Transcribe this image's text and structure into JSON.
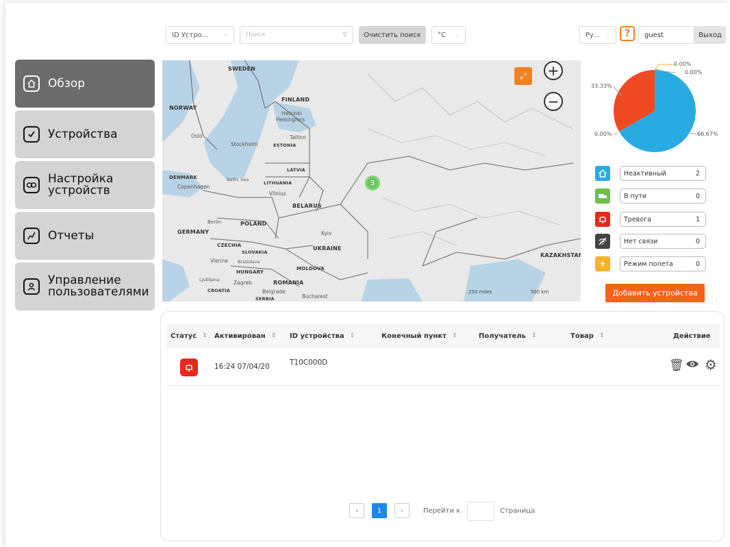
{
  "topbar": {
    "device_select": "ID Устро...",
    "search_placeholder": "Поиск",
    "clear_button": "Очистить поиск",
    "temp_unit": "°C",
    "language": "Ру...",
    "help": "?",
    "username": "guest",
    "logout": "Выход"
  },
  "sidebar": {
    "items": [
      {
        "label": "Обзор",
        "icon": "home-icon"
      },
      {
        "label": "Устройства",
        "icon": "check-icon"
      },
      {
        "label": "Настройка\nустройств",
        "icon": "link-icon"
      },
      {
        "label": "Отчеты",
        "icon": "chart-icon"
      },
      {
        "label": "Управление\nпользователями",
        "icon": "user-icon"
      }
    ]
  },
  "map": {
    "countries": [
      "SWEDEN",
      "NORWAY",
      "FINLAND",
      "ESTONIA",
      "LATVIA",
      "DENMARK",
      "LITHUANIA",
      "BELARUS",
      "POLAND",
      "GERMANY",
      "CZECHIA",
      "SLOVAKIA",
      "UKRAINE",
      "HUNGARY",
      "MOLDOVA",
      "ROMANIA",
      "CROATIA",
      "SERBIA",
      "KAZAKHSTAN"
    ],
    "cities": [
      "Helsinki",
      "Helsingfors",
      "Oslo",
      "Stockholm",
      "Tallinn",
      "Copenhagen",
      "Baltic Sea",
      "Vilnius",
      "Berlin",
      "Kyiv",
      "Vienna",
      "Bratislava",
      "Zagreb",
      "Ljubljana",
      "Belgrade",
      "Bucharest"
    ],
    "cluster_count": "3",
    "scale_miles": "250 miles",
    "scale_km": "500 km"
  },
  "chart_data": {
    "type": "pie",
    "slices": [
      {
        "label": "Неактивный",
        "value": 66.67,
        "color": "#29abe2"
      },
      {
        "label": "Тревога",
        "value": 33.33,
        "color": "#f04a23"
      },
      {
        "label": "В пути",
        "value": 0.0
      },
      {
        "label": "Нет связи",
        "value": 0.0
      },
      {
        "label": "Режим полета",
        "value": 0.0
      }
    ],
    "pct_labels": [
      "0.00%",
      "0.00%",
      "33.33%",
      "0.00%",
      "66.67%"
    ]
  },
  "legend": [
    {
      "label": "Неактивный",
      "count": "2",
      "color": "#29abe2",
      "icon": "home-icon"
    },
    {
      "label": "В пути",
      "count": "0",
      "color": "#6cc04a",
      "icon": "truck-icon"
    },
    {
      "label": "Тревога",
      "count": "1",
      "color": "#e8281e",
      "icon": "bell-icon"
    },
    {
      "label": "Нет связи",
      "count": "0",
      "color": "#444444",
      "icon": "no-signal-icon"
    },
    {
      "label": "Режим полета",
      "count": "0",
      "color": "#f5b32a",
      "icon": "plane-icon"
    }
  ],
  "add_devices_button": "Добавить устройства",
  "table": {
    "headers": [
      "Статус",
      "Активирован",
      "ID устройства",
      "Конечный пункт",
      "Получатель",
      "Товар",
      "Действие"
    ],
    "rows": [
      {
        "activated": "16:24 07/04/20",
        "device_id": "T10C000D",
        "destination": "",
        "recipient": "",
        "goods": ""
      }
    ]
  },
  "pagination": {
    "current": "1",
    "goto_label": "Перейти к",
    "page_label": "Страница"
  }
}
